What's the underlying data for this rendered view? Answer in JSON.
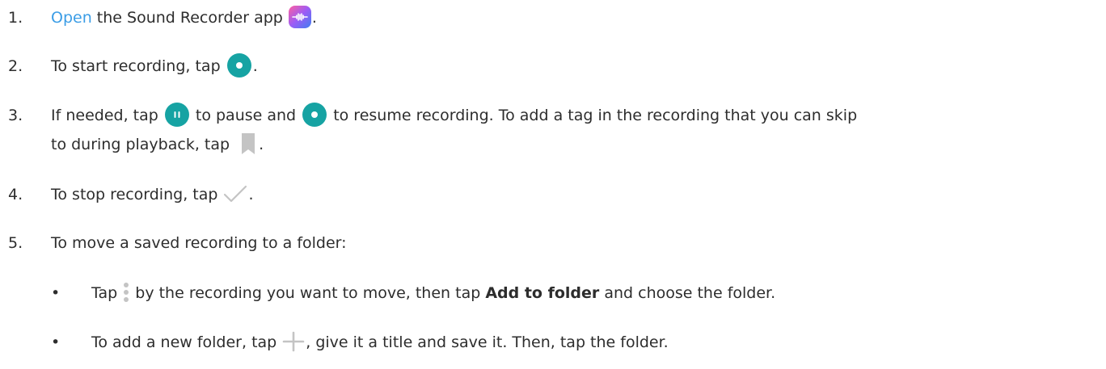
{
  "steps": [
    {
      "num": "1.",
      "link": "Open",
      "t1": " the Sound Recorder app ",
      "t2": "."
    },
    {
      "num": "2.",
      "t1": "To start recording, tap ",
      "t2": "."
    },
    {
      "num": "3.",
      "t1": "If needed, tap ",
      "t2": " to pause and ",
      "t3": " to resume recording. To add a tag in the recording that you can skip",
      "t4": "to during playback, tap ",
      "t5": "."
    },
    {
      "num": "4.",
      "t1": "To stop recording, tap ",
      "t2": "."
    },
    {
      "num": "5.",
      "t1": "To move a saved recording to a folder:"
    }
  ],
  "bullets": [
    {
      "symbol": "•",
      "t1": "Tap ",
      "t2": " by the recording you want to move, then tap ",
      "bold": "Add to folder",
      "t3": " and choose the folder."
    },
    {
      "symbol": "•",
      "t1": "To add a new folder, tap ",
      "t2": ", give it a title and save it. Then, tap the folder."
    }
  ],
  "icons": {
    "app": "sound-recorder-app-icon",
    "record": "record-icon",
    "pause": "pause-icon",
    "bookmark": "bookmark-icon",
    "check": "check-icon",
    "more": "more-options-icon",
    "add": "add-icon"
  },
  "colors": {
    "link": "#3b9de6",
    "teal": "#16a3a3",
    "gray": "#c4c4c4"
  }
}
